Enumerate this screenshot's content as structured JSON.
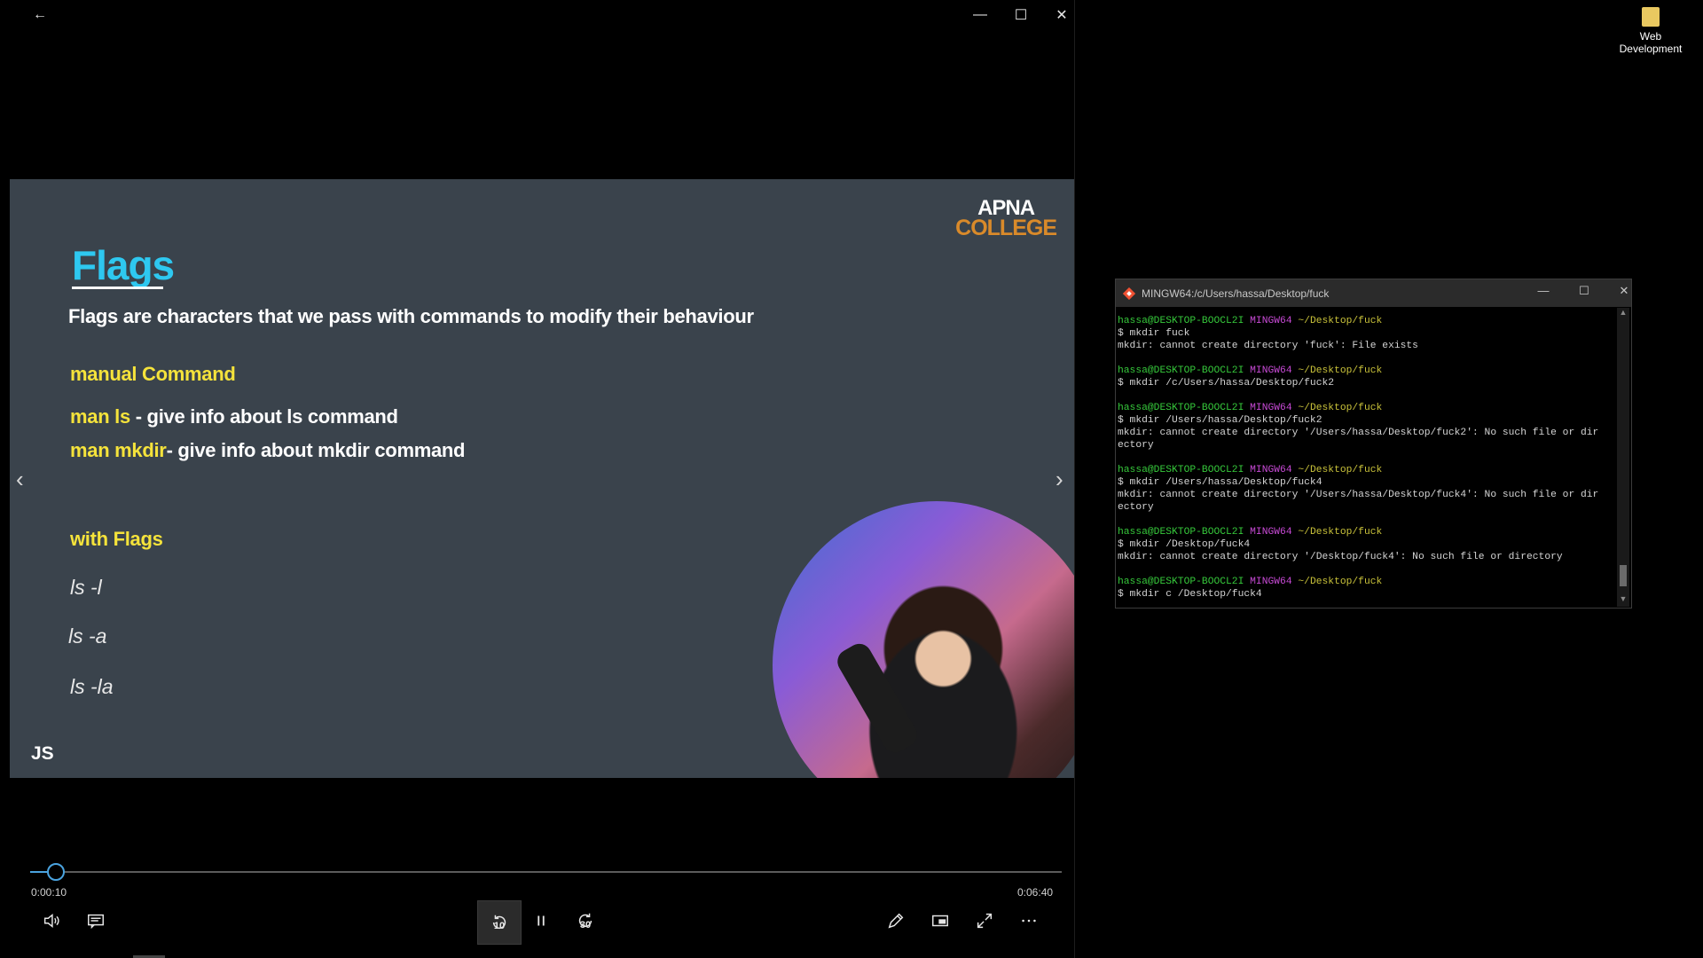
{
  "player": {
    "window_controls": {
      "minimize": "—",
      "maximize": "☐",
      "close": "✕",
      "back": "←"
    },
    "slide": {
      "title": "Flags",
      "subtitle": "Flags are characters that we pass with commands to modify their behaviour",
      "manual_heading": "manual Command",
      "man_ls_cmd": "man ls",
      "man_ls_desc": " - give info about ls command",
      "man_mkdir_cmd": "man mkdir",
      "man_mkdir_desc": "- give info about mkdir command",
      "flags_heading": "with Flags",
      "flag_examples": [
        "ls -l",
        "ls -a",
        "ls -la"
      ],
      "logo_top": "APNA",
      "logo_bottom": "COLLEGE",
      "js_label": "JS"
    },
    "nav": {
      "prev": "‹",
      "next": "›"
    },
    "progress": {
      "current_time": "0:00:10",
      "total_time": "0:06:40",
      "fraction": 0.025
    },
    "controls": {
      "skip_back_seconds": "10",
      "skip_forward_seconds": "30"
    }
  },
  "terminal": {
    "title": "MINGW64:/c/Users/hassa/Desktop/fuck",
    "prompt_user": "hassa@DESKTOP-BOOCL2I",
    "prompt_env": "MINGW64",
    "prompt_path": "~/Desktop/fuck",
    "blocks": [
      {
        "cmd": "$ mkdir fuck",
        "output": [
          "mkdir: cannot create directory 'fuck': File exists"
        ]
      },
      {
        "cmd": "$ mkdir /c/Users/hassa/Desktop/fuck2",
        "output": []
      },
      {
        "cmd": "$ mkdir /Users/hassa/Desktop/fuck2",
        "output": [
          "mkdir: cannot create directory '/Users/hassa/Desktop/fuck2': No such file or dir",
          "ectory"
        ]
      },
      {
        "cmd": "$ mkdir /Users/hassa/Desktop/fuck4",
        "output": [
          "mkdir: cannot create directory '/Users/hassa/Desktop/fuck4': No such file or dir",
          "ectory"
        ]
      },
      {
        "cmd": "$ mkdir /Desktop/fuck4",
        "output": [
          "mkdir: cannot create directory '/Desktop/fuck4': No such file or directory"
        ]
      },
      {
        "cmd": "$ mkdir c /Desktop/fuck4",
        "output": []
      }
    ]
  },
  "desktop": {
    "folder_label_line1": "Web",
    "folder_label_line2": "Development"
  }
}
